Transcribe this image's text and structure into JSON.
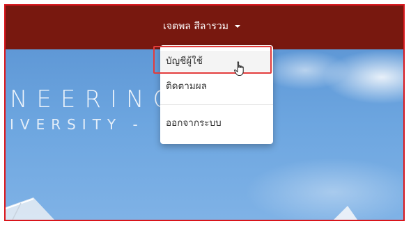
{
  "navbar": {
    "user_name": "เจตพล สีลารวม",
    "caret_icon": "caret-down-icon"
  },
  "hero": {
    "line1": "NEERING",
    "line2": "IVERSITY -"
  },
  "dropdown": {
    "items": [
      {
        "label": "บัญชีผู้ใช้",
        "highlighted": true
      },
      {
        "label": "ติดตามผล"
      },
      {
        "label": "ออกจากระบบ"
      }
    ]
  },
  "colors": {
    "navbar": "#78180f",
    "frame_border": "#d9151b",
    "highlight_border": "#e23b3b",
    "sky": "#6da6e0"
  },
  "cursor": "hand-pointer-icon"
}
